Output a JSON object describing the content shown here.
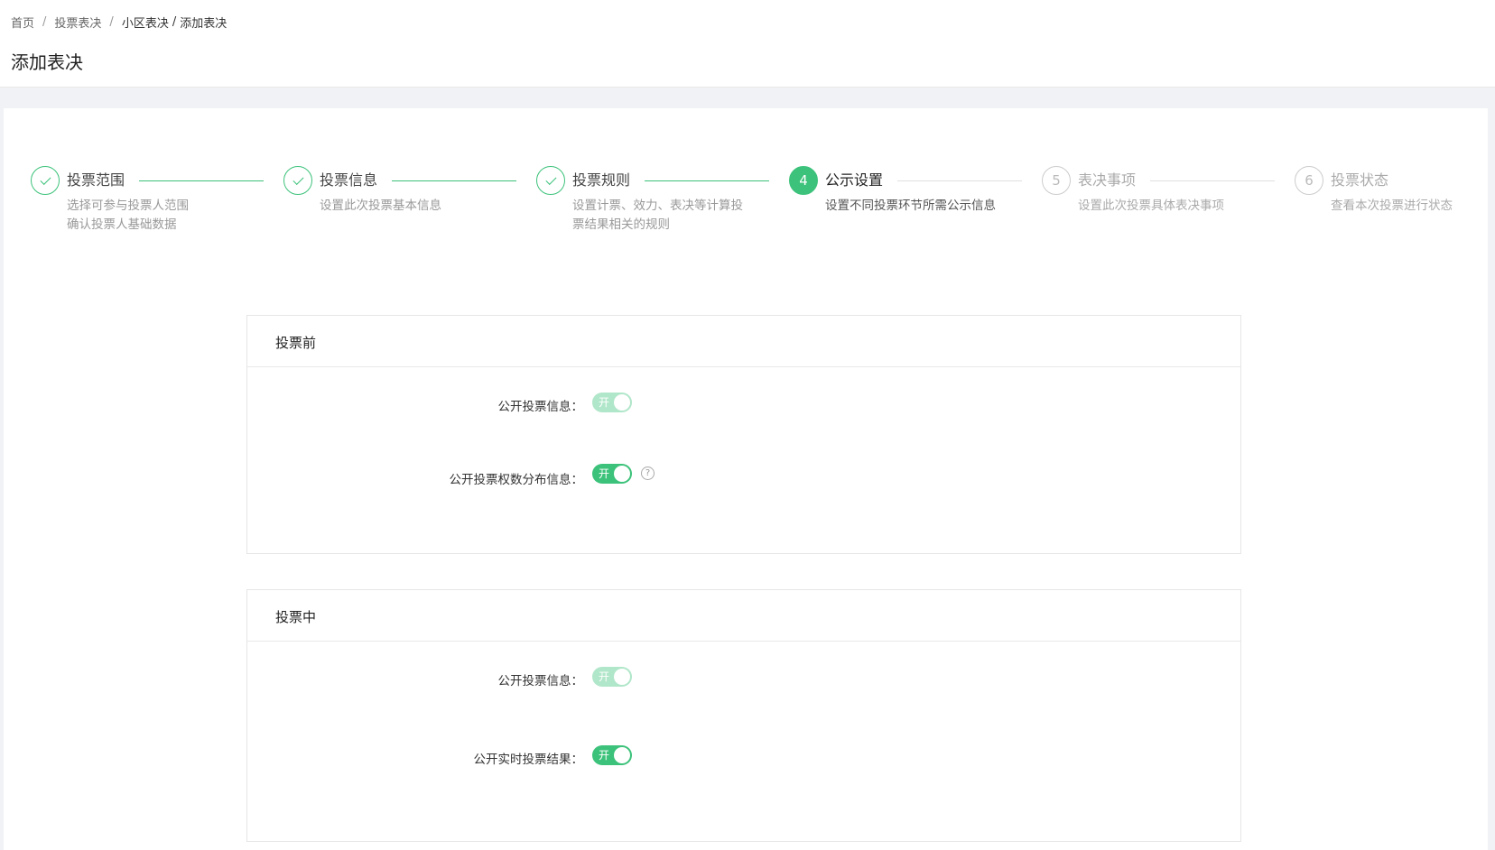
{
  "breadcrumb": {
    "items": [
      "首页",
      "投票表决",
      "小区表决"
    ],
    "current": "添加表决",
    "separator": "/"
  },
  "page_title": "添加表决",
  "steps": [
    {
      "number": "1",
      "title": "投票范围",
      "desc": [
        "选择可参与投票人范围",
        "确认投票人基础数据"
      ],
      "status": "done"
    },
    {
      "number": "2",
      "title": "投票信息",
      "desc": [
        "设置此次投票基本信息"
      ],
      "status": "done"
    },
    {
      "number": "3",
      "title": "投票规则",
      "desc": [
        "设置计票、效力、表决等计算投",
        "票结果相关的规则"
      ],
      "status": "done"
    },
    {
      "number": "4",
      "title": "公示设置",
      "desc": [
        "设置不同投票环节所需公示信息"
      ],
      "status": "active"
    },
    {
      "number": "5",
      "title": "表决事项",
      "desc": [
        "设置此次投票具体表决事项"
      ],
      "status": "wait"
    },
    {
      "number": "6",
      "title": "投票状态",
      "desc": [
        "查看本次投票进行状态"
      ],
      "status": "wait"
    }
  ],
  "sections": [
    {
      "title": "投票前",
      "rows": [
        {
          "label": "公开投票信息：",
          "switch_text": "开",
          "on": true,
          "disabled": true
        },
        {
          "label": "公开投票权数分布信息：",
          "switch_text": "开",
          "on": true,
          "disabled": false,
          "help": "?"
        }
      ]
    },
    {
      "title": "投票中",
      "rows": [
        {
          "label": "公开投票信息：",
          "switch_text": "开",
          "on": true,
          "disabled": true
        },
        {
          "label": "公开实时投票结果：",
          "switch_text": "开",
          "on": true,
          "disabled": false
        }
      ]
    }
  ],
  "colors": {
    "accent": "#3cc27a",
    "background": "#f0f2f5"
  }
}
